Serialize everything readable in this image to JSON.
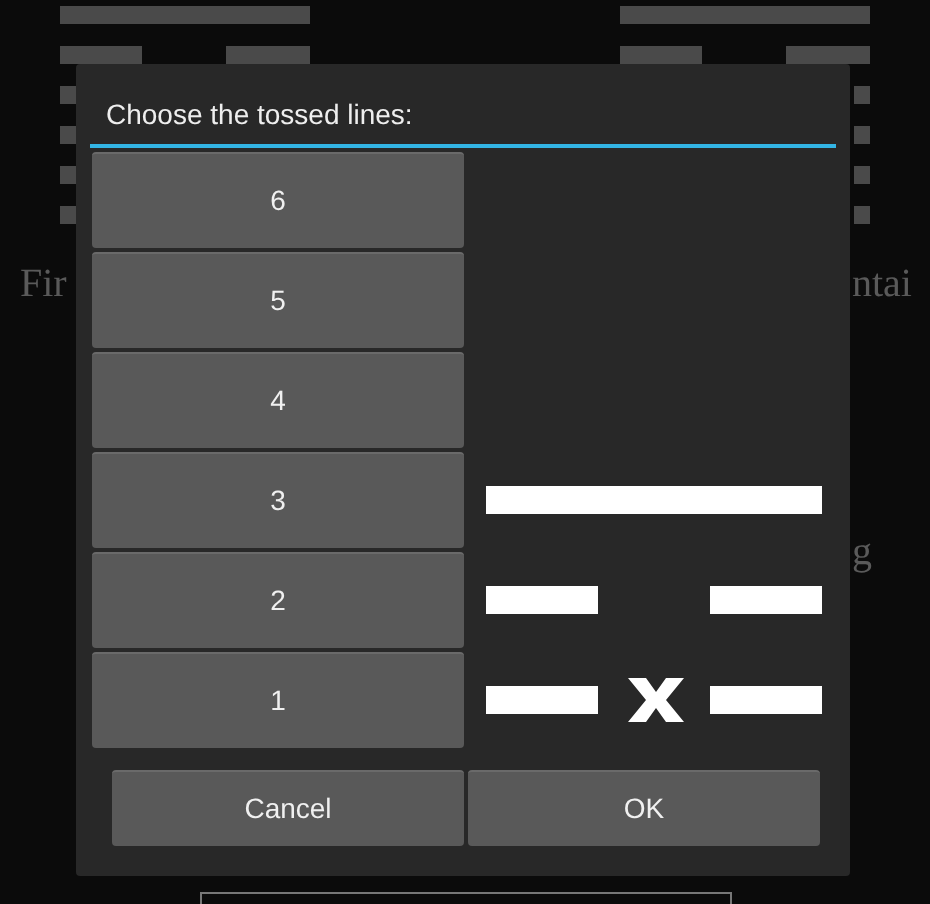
{
  "background": {
    "texts": [
      "Fir",
      "ntai",
      "g"
    ]
  },
  "dialog": {
    "title": "Choose the tossed lines:",
    "lines": [
      {
        "label": "6",
        "kind": "none"
      },
      {
        "label": "5",
        "kind": "none"
      },
      {
        "label": "4",
        "kind": "none"
      },
      {
        "label": "3",
        "kind": "solid"
      },
      {
        "label": "2",
        "kind": "broken"
      },
      {
        "label": "1",
        "kind": "broken_moving"
      }
    ],
    "buttons": [
      "Cancel",
      "OK"
    ]
  }
}
